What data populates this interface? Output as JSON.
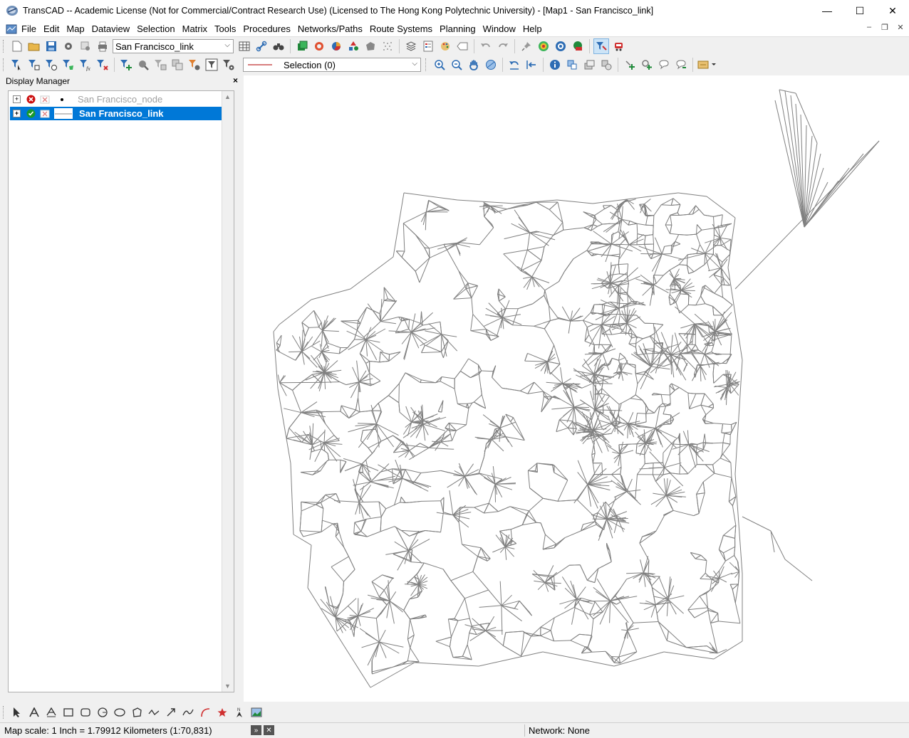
{
  "window": {
    "title": "TransCAD -- Academic License (Not for Commercial/Contract Research Use) (Licensed to The Hong Kong Polytechnic University) - [Map1 - San Francisco_link]",
    "minimize": "—",
    "maximize": "☐",
    "close": "✕"
  },
  "menu": {
    "items": [
      "File",
      "Edit",
      "Map",
      "Dataview",
      "Selection",
      "Matrix",
      "Tools",
      "Procedures",
      "Networks/Paths",
      "Route Systems",
      "Planning",
      "Window",
      "Help"
    ]
  },
  "mdi": {
    "minimize": "–",
    "restore": "❐",
    "close": "✕"
  },
  "toolbar": {
    "layer_combo": "San Francisco_link",
    "selection_combo": "Selection (0)"
  },
  "display_manager": {
    "title": "Display Manager",
    "close": "×",
    "layers": [
      {
        "name": "San Francisco_node",
        "visible": false,
        "selected": false
      },
      {
        "name": "San Francisco_link",
        "visible": true,
        "selected": true
      }
    ]
  },
  "status": {
    "scale": "Map scale: 1 Inch = 1.79912 Kilometers (1:70,831)",
    "network": "Network: None",
    "btn_expand": "»",
    "btn_close": "✕"
  },
  "colors": {
    "selection_blue": "#0078d7",
    "map_lines": "#808080",
    "visible_check": "#1a9a2a",
    "hidden_x": "#cc1010"
  }
}
